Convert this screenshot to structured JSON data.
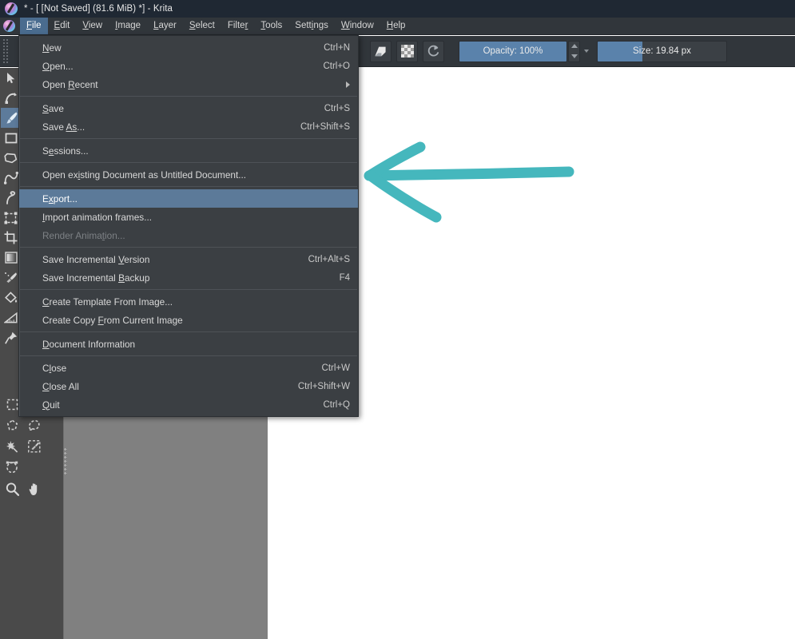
{
  "window": {
    "title": "* - [ [Not Saved]  (81.6 MiB) *] - Krita",
    "logo_icon": "krita-logo-icon"
  },
  "menubar": {
    "items": [
      {
        "label": "File",
        "acc": "F",
        "active": true
      },
      {
        "label": "Edit",
        "acc": "E",
        "active": false
      },
      {
        "label": "View",
        "acc": "V",
        "active": false
      },
      {
        "label": "Image",
        "acc": "I",
        "active": false
      },
      {
        "label": "Layer",
        "acc": "L",
        "active": false
      },
      {
        "label": "Select",
        "acc": "S",
        "active": false
      },
      {
        "label": "Filter",
        "acc": "r",
        "active": false
      },
      {
        "label": "Tools",
        "acc": "T",
        "active": false
      },
      {
        "label": "Settings",
        "acc": "i",
        "active": false
      },
      {
        "label": "Window",
        "acc": "W",
        "active": false
      },
      {
        "label": "Help",
        "acc": "H",
        "active": false
      }
    ]
  },
  "toolbar": {
    "preset_combo_placeholder": "",
    "eraser_icon": "eraser-icon",
    "alpha_lock_icon": "checkerboard-icon",
    "reload_preset_icon": "reload-icon",
    "opacity_label": "Opacity: 100%",
    "opacity_value": 100,
    "size_label": "Size: 19.84 px",
    "size_value": 19.84,
    "size_fill_percent": 35
  },
  "toolbox": {
    "tools": [
      {
        "name": "shape-select-tool",
        "icon": "cursor-arrow-icon",
        "selected": false
      },
      {
        "name": "edit-shapes-tool",
        "icon": "bezier-node-icon",
        "selected": false
      },
      {
        "name": "freehand-brush-tool",
        "icon": "paintbrush-icon",
        "selected": true
      },
      {
        "name": "rectangle-tool",
        "icon": "rectangle-icon",
        "selected": false
      },
      {
        "name": "polygon-tool",
        "icon": "polygon-icon",
        "selected": false
      },
      {
        "name": "bezier-curve-tool",
        "icon": "bezier-curve-icon",
        "selected": false
      },
      {
        "name": "freehand-path-tool",
        "icon": "freehand-path-icon",
        "selected": false
      },
      {
        "name": "transform-tool",
        "icon": "transform-icon",
        "selected": false
      },
      {
        "name": "crop-tool",
        "icon": "crop-icon",
        "selected": false
      },
      {
        "name": "gradient-tool",
        "icon": "gradient-icon",
        "selected": false
      },
      {
        "name": "colorize-mask-tool",
        "icon": "colorize-brush-icon",
        "selected": false
      },
      {
        "name": "fill-tool",
        "icon": "paint-bucket-icon",
        "selected": false
      },
      {
        "name": "measure-tool",
        "icon": "ruler-icon",
        "selected": false
      },
      {
        "name": "assistant-tool",
        "icon": "pin-icon",
        "selected": false
      }
    ],
    "selection_tools": [
      {
        "name": "rectangular-selection-tool",
        "icon": "marquee-rect-icon"
      },
      {
        "name": "elliptical-selection-tool",
        "icon": "marquee-ellipse-icon"
      },
      {
        "name": "polygonal-selection-tool",
        "icon": "marquee-polygon-icon"
      },
      {
        "name": "freehand-selection-tool",
        "icon": "marquee-lasso-icon"
      },
      {
        "name": "contiguous-selection-tool",
        "icon": "magic-wand-icon"
      },
      {
        "name": "similar-color-selection-tool",
        "icon": "similar-select-icon"
      },
      {
        "name": "bezier-selection-tool",
        "icon": "bezier-select-icon"
      }
    ],
    "view_tools": [
      {
        "name": "zoom-tool",
        "icon": "magnifier-icon"
      },
      {
        "name": "pan-tool",
        "icon": "hand-icon"
      }
    ]
  },
  "file_menu": {
    "groups": [
      [
        {
          "label": "New",
          "acc": "N",
          "shortcut": "Ctrl+N"
        },
        {
          "label": "Open...",
          "acc": "O",
          "shortcut": "Ctrl+O"
        },
        {
          "label": "Open Recent",
          "acc": "R",
          "shortcut": "",
          "submenu": true
        }
      ],
      [
        {
          "label": "Save",
          "acc": "S",
          "shortcut": "Ctrl+S"
        },
        {
          "label": "Save As...",
          "acc": "As",
          "shortcut": "Ctrl+Shift+S"
        }
      ],
      [
        {
          "label": "Sessions...",
          "acc": "e",
          "shortcut": ""
        }
      ],
      [
        {
          "label": "Open existing Document as Untitled Document...",
          "acc": "i",
          "shortcut": ""
        }
      ],
      [
        {
          "label": "Export...",
          "acc": "x",
          "shortcut": "",
          "highlighted": true
        },
        {
          "label": "Import animation frames...",
          "acc": "I",
          "shortcut": ""
        },
        {
          "label": "Render Animation...",
          "acc": "t",
          "shortcut": "",
          "disabled": true
        }
      ],
      [
        {
          "label": "Save Incremental Version",
          "acc": "V",
          "shortcut": "Ctrl+Alt+S"
        },
        {
          "label": "Save Incremental Backup",
          "acc": "B",
          "shortcut": "F4"
        }
      ],
      [
        {
          "label": "Create Template From Image...",
          "acc": "C",
          "shortcut": ""
        },
        {
          "label": "Create Copy From Current Image",
          "acc": "F",
          "shortcut": ""
        }
      ],
      [
        {
          "label": "Document Information",
          "acc": "D",
          "shortcut": ""
        }
      ],
      [
        {
          "label": "Close",
          "acc": "l",
          "shortcut": "Ctrl+W"
        },
        {
          "label": "Close All",
          "acc": "C",
          "shortcut": "Ctrl+Shift+W"
        },
        {
          "label": "Quit",
          "acc": "Q",
          "shortcut": "Ctrl+Q"
        }
      ]
    ]
  },
  "annotation": {
    "arrow_icon": "hand-drawn-left-arrow-icon",
    "color": "#45b7bd",
    "direction": "left"
  },
  "colors": {
    "titlebar_bg": "#1f2833",
    "chrome_bg": "#31363b",
    "menu_bg": "#3b3f43",
    "menu_highlight": "#5c7a99",
    "toolbox_bg": "#4a4a4a",
    "document_grey": "#808080",
    "canvas_white": "#ffffff",
    "accent_blue": "#5a82ab",
    "annotation_teal": "#45b7bd"
  }
}
